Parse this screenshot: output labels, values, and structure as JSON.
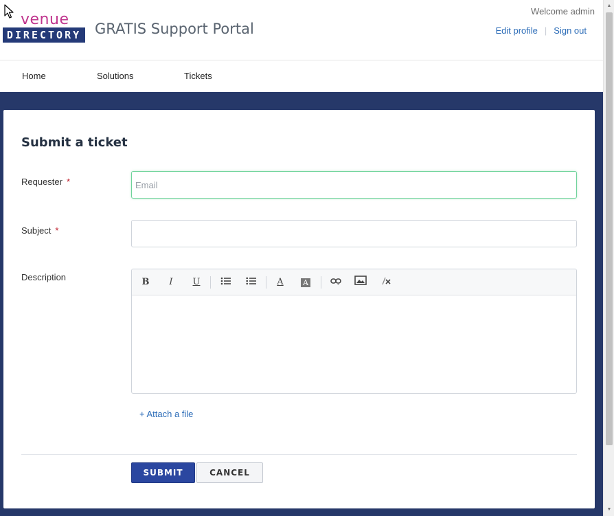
{
  "header": {
    "logo_top": "venue",
    "logo_bottom": "DIRECTORY",
    "portal_title": "GRATIS Support Portal",
    "welcome": "Welcome admin",
    "edit_profile": "Edit profile",
    "sign_out": "Sign out"
  },
  "nav": {
    "items": [
      "Home",
      "Solutions",
      "Tickets"
    ]
  },
  "form": {
    "title": "Submit a ticket",
    "requester_label": "Requester",
    "requester_placeholder": "Email",
    "requester_value": "",
    "subject_label": "Subject",
    "subject_value": "",
    "required_mark": "*",
    "description_label": "Description",
    "attach": "+ Attach a file",
    "submit": "SUBMIT",
    "cancel": "CANCEL"
  },
  "toolbar": {
    "bold": "B",
    "italic": "I",
    "underline": "U",
    "font_color": "A",
    "bg_color": "A"
  },
  "colors": {
    "accent": "#2b47a0",
    "band": "#263869",
    "link": "#2d6db8",
    "logo_pink": "#c0368e",
    "focus_border": "#6fd39b",
    "required": "#c0202e"
  }
}
